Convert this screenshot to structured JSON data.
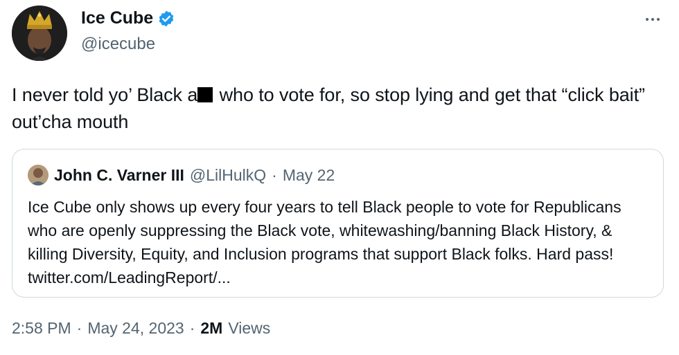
{
  "author": {
    "display_name": "Ice Cube",
    "handle": "@icecube",
    "verified": true,
    "avatar_icon": "crowned-man-avatar"
  },
  "more_icon": "more-options-icon",
  "tweet": {
    "text_before": "I never told yo’ Black a",
    "text_after": " who to vote for, so stop lying and get that “click bait” out’cha mouth"
  },
  "quote": {
    "display_name": "John C. Varner III",
    "handle": "@LilHulkQ",
    "separator": "·",
    "date": "May 22",
    "text": "Ice Cube only shows up every four years to tell Black people to vote for Republicans who are openly suppressing the Black vote, whitewashing/banning Black History, & killing Diversity, Equity, and Inclusion programs that support Black folks. Hard pass! twitter.com/LeadingReport/..."
  },
  "meta": {
    "time": "2:58 PM",
    "sep1": "·",
    "date": "May 24, 2023",
    "sep2": "·",
    "views_count": "2M",
    "views_label": "Views"
  },
  "colors": {
    "verified_blue": "#1d9bf0",
    "secondary_text": "#536471",
    "border": "#cfd9de"
  }
}
